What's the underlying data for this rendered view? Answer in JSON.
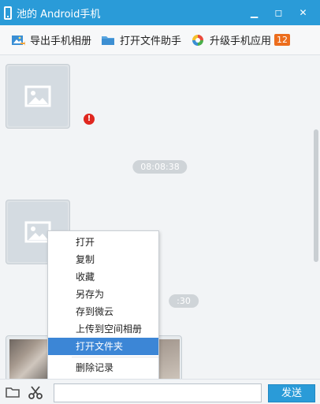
{
  "window": {
    "title": "池的 Android手机",
    "minimize": "▁",
    "restore": "◻",
    "close": "✕"
  },
  "toolbar": {
    "export_album": "导出手机相册",
    "open_file_helper": "打开文件助手",
    "upgrade_apps": "升级手机应用",
    "upgrade_count": "12"
  },
  "chat": {
    "timestamps": [
      "08:08:38",
      ":30"
    ],
    "error_mark": "!"
  },
  "context_menu": {
    "items": [
      "打开",
      "复制",
      "收藏",
      "另存为",
      "存到微云",
      "上传到空间相册",
      "打开文件夹",
      "删除记录"
    ],
    "selected": "打开文件夹"
  },
  "composer": {
    "input_value": "",
    "send_label": "发送"
  },
  "colors": {
    "titlebar": "#2a9bd8",
    "menu_highlight": "#3c86d6",
    "badge": "#ec6d1d",
    "error": "#e0271f"
  }
}
